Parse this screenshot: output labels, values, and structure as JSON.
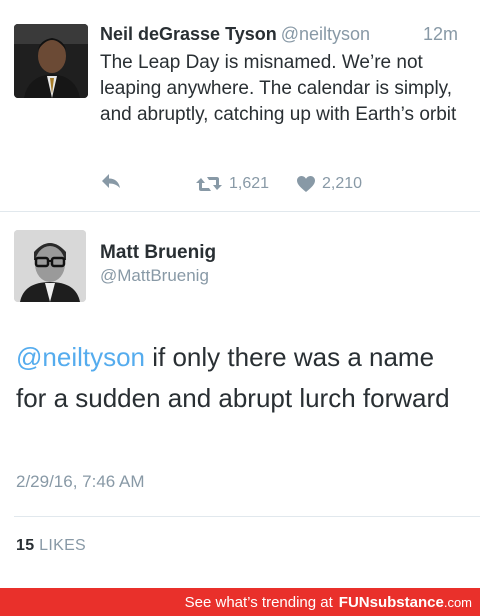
{
  "tweet1": {
    "name": "Neil deGrasse Tyson",
    "handle": "@neiltyson",
    "time": "12m",
    "text": "The Leap Day is misnamed. We’re not leaping anywhere. The calendar is simply, and abruptly, catching up with Earth’s orbit",
    "retweets": "1,621",
    "likes": "2,210",
    "icons": {
      "reply": "reply-icon",
      "retweet": "retweet-icon",
      "like": "heart-icon"
    }
  },
  "tweet2": {
    "name": "Matt Bruenig",
    "handle": "@MattBruenig",
    "mention": "@neiltyson",
    "text": " if only there was a name for a sudden and abrupt lurch forward",
    "date": "2/29/16, 7:46 AM",
    "likes_count": "15",
    "likes_label": "LIKES"
  },
  "footer": {
    "text": "See what’s trending at",
    "brand_fun": "FUN",
    "brand_substance": "substance",
    "brand_com": ".com"
  },
  "colors": {
    "link": "#55acee",
    "muted": "#8899a6",
    "text": "#292f33",
    "footer_bg": "#e9302b"
  }
}
